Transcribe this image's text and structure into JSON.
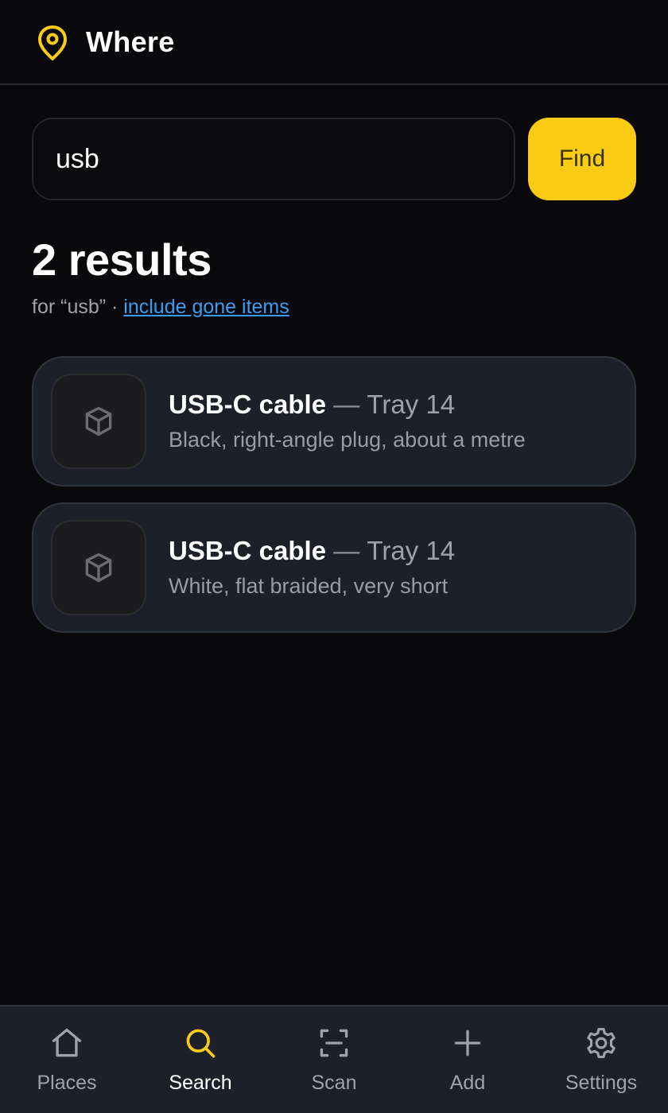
{
  "header": {
    "title": "Where",
    "logo_icon": "map-pin-icon",
    "accent": "#facc15"
  },
  "search": {
    "value": "usb",
    "placeholder": "",
    "find_label": "Find"
  },
  "results": {
    "count_label": "2 results",
    "for_label": "for “usb” · ",
    "include_gone_label": "include gone items"
  },
  "items": [
    {
      "name": "USB-C cable",
      "separator": "—",
      "place": "Tray 14",
      "description": "Black, right-angle plug, about a metre",
      "icon": "box-icon"
    },
    {
      "name": "USB-C cable",
      "separator": "—",
      "place": "Tray 14",
      "description": "White, flat braided, very short",
      "icon": "box-icon"
    }
  ],
  "nav": {
    "active": "Search",
    "items": [
      {
        "label": "Places",
        "icon": "home-icon"
      },
      {
        "label": "Search",
        "icon": "search-icon"
      },
      {
        "label": "Scan",
        "icon": "scan-icon"
      },
      {
        "label": "Add",
        "icon": "plus-icon"
      },
      {
        "label": "Settings",
        "icon": "gear-icon"
      }
    ]
  }
}
